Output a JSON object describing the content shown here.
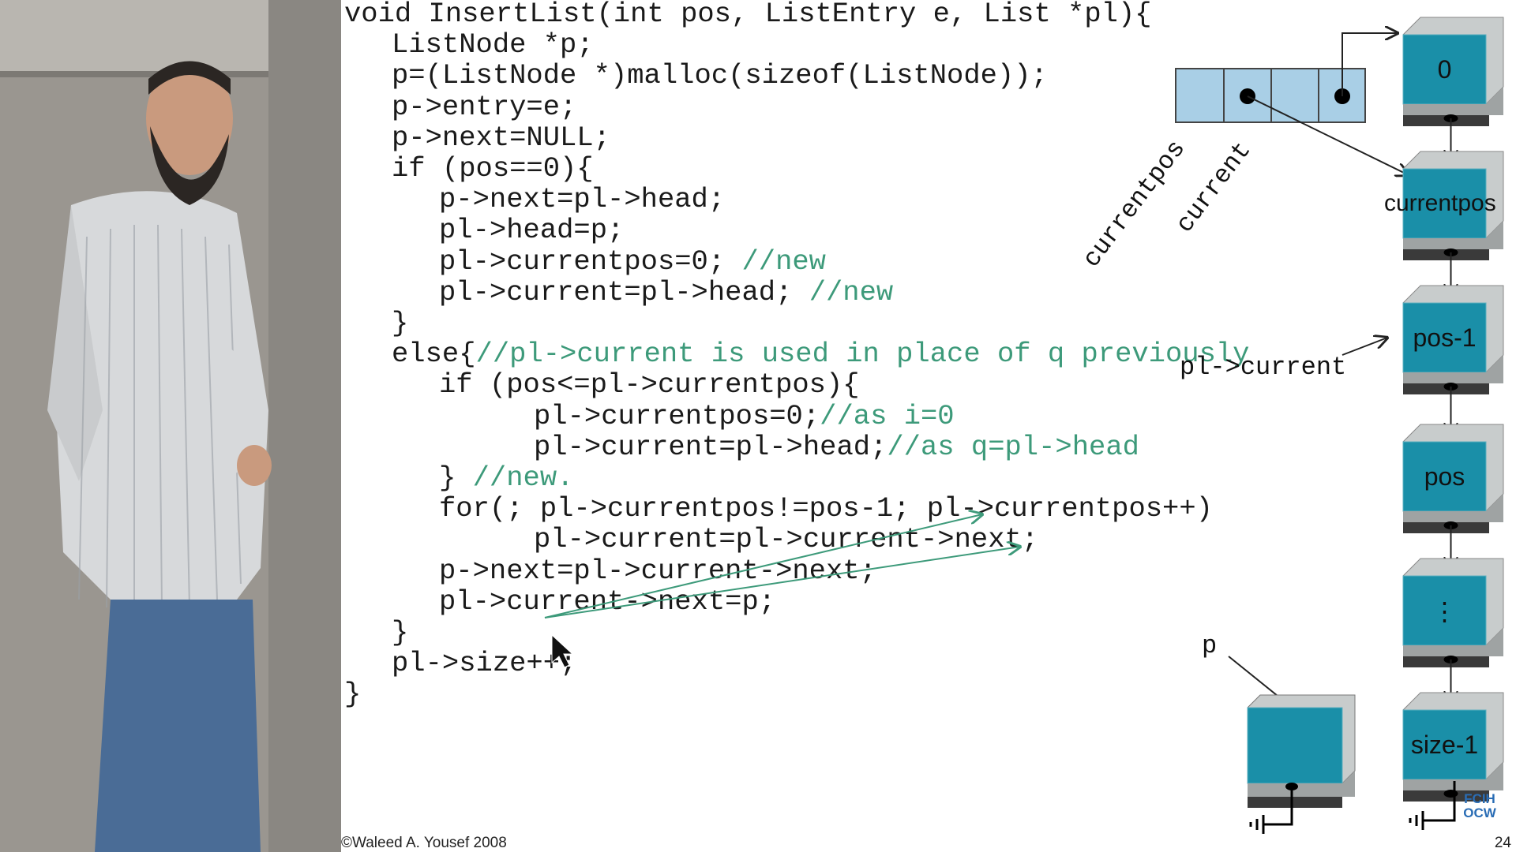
{
  "code": {
    "lines": [
      {
        "indent": 0,
        "code": "void InsertList(int pos, ListEntry e, List *pl){",
        "comment": ""
      },
      {
        "indent": 1,
        "code": "ListNode *p;",
        "comment": ""
      },
      {
        "indent": 1,
        "code": "p=(ListNode *)malloc(sizeof(ListNode));",
        "comment": ""
      },
      {
        "indent": 1,
        "code": "p->entry=e;",
        "comment": ""
      },
      {
        "indent": 1,
        "code": "p->next=NULL;",
        "comment": ""
      },
      {
        "indent": 1,
        "code": "if (pos==0){",
        "comment": ""
      },
      {
        "indent": 2,
        "code": "p->next=pl->head;",
        "comment": ""
      },
      {
        "indent": 2,
        "code": "pl->head=p;",
        "comment": ""
      },
      {
        "indent": 2,
        "code": "pl->currentpos=0; ",
        "comment": "//new"
      },
      {
        "indent": 2,
        "code": "pl->current=pl->head; ",
        "comment": "//new"
      },
      {
        "indent": 1,
        "code": "}",
        "comment": ""
      },
      {
        "indent": 1,
        "code": "else{",
        "comment": "//pl->current is used in place of q previously"
      },
      {
        "indent": 2,
        "code": "if (pos<=pl->currentpos){",
        "comment": ""
      },
      {
        "indent": 4,
        "code": "pl->currentpos=0;",
        "comment": "//as i=0"
      },
      {
        "indent": 4,
        "code": "pl->current=pl->head;",
        "comment": "//as q=pl->head"
      },
      {
        "indent": 2,
        "code": "} ",
        "comment": "//new."
      },
      {
        "indent": 2,
        "code": "for(; pl->currentpos!=pos-1; pl->currentpos++)",
        "comment": ""
      },
      {
        "indent": 4,
        "code": "pl->current=pl->current->next;",
        "comment": ""
      },
      {
        "indent": 2,
        "code": "p->next=pl->current->next;",
        "comment": ""
      },
      {
        "indent": 2,
        "code": "pl->current->next=p;",
        "comment": ""
      },
      {
        "indent": 1,
        "code": "}",
        "comment": ""
      },
      {
        "indent": 1,
        "code": "pl->size++;",
        "comment": ""
      },
      {
        "indent": 0,
        "code": "}",
        "comment": ""
      }
    ]
  },
  "diagram": {
    "nodes": [
      "0",
      "currentpos",
      "pos-1",
      "pos",
      "⋮",
      "size-1"
    ],
    "list_struct_labels": [
      "currentpos",
      "current"
    ],
    "pointer_labels": {
      "pl_current": "pl->current",
      "p": "p"
    }
  },
  "footer": {
    "copyright": "©Waleed A. Yousef 2008",
    "page_number": "24",
    "logo_line1": "FCIH",
    "logo_line2": "OCW"
  },
  "colors": {
    "node_teal": "#1a8fa8",
    "node_shadow": "#3a3a3a",
    "node_side": "#c8cccc",
    "comment_green": "#3d9a7a",
    "struct_fill": "#a9cfe6"
  }
}
